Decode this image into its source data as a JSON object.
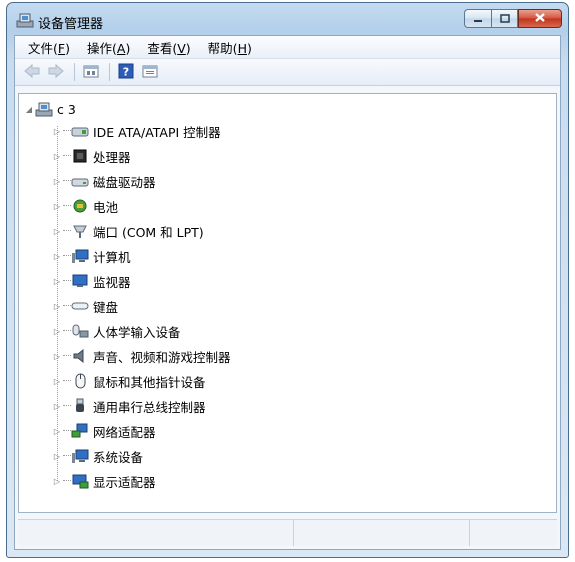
{
  "window": {
    "title": "设备管理器",
    "buttons": [
      "minimize",
      "maximize",
      "close"
    ]
  },
  "menu": [
    {
      "label": "文件(",
      "key": "F",
      "suffix": ")"
    },
    {
      "label": "操作(",
      "key": "A",
      "suffix": ")"
    },
    {
      "label": "查看(",
      "key": "V",
      "suffix": ")"
    },
    {
      "label": "帮助(",
      "key": "H",
      "suffix": ")"
    }
  ],
  "toolbar": {
    "items": [
      "back-icon",
      "forward-icon",
      "properties-view-icon",
      "help-icon",
      "console-view-icon"
    ]
  },
  "tree": {
    "root": {
      "label": "c   3",
      "icon": "computer-root-icon",
      "expanded": true
    },
    "children": [
      {
        "label": "IDE ATA/ATAPI 控制器",
        "icon": "ide-controller-icon"
      },
      {
        "label": "处理器",
        "icon": "processor-icon"
      },
      {
        "label": "磁盘驱动器",
        "icon": "disk-drive-icon"
      },
      {
        "label": "电池",
        "icon": "battery-icon"
      },
      {
        "label": "端口 (COM 和 LPT)",
        "icon": "port-icon"
      },
      {
        "label": "计算机",
        "icon": "computer-icon"
      },
      {
        "label": "监视器",
        "icon": "monitor-icon"
      },
      {
        "label": "键盘",
        "icon": "keyboard-icon"
      },
      {
        "label": "人体学输入设备",
        "icon": "hid-icon"
      },
      {
        "label": "声音、视频和游戏控制器",
        "icon": "sound-icon"
      },
      {
        "label": "鼠标和其他指针设备",
        "icon": "mouse-icon"
      },
      {
        "label": "通用串行总线控制器",
        "icon": "usb-icon"
      },
      {
        "label": "网络适配器",
        "icon": "network-adapter-icon"
      },
      {
        "label": "系统设备",
        "icon": "system-device-icon"
      },
      {
        "label": "显示适配器",
        "icon": "display-adapter-icon"
      }
    ]
  },
  "colors": {
    "title_bar": "#b3cfea",
    "close_button": "#c2331d",
    "tree_bg": "#ffffff"
  }
}
